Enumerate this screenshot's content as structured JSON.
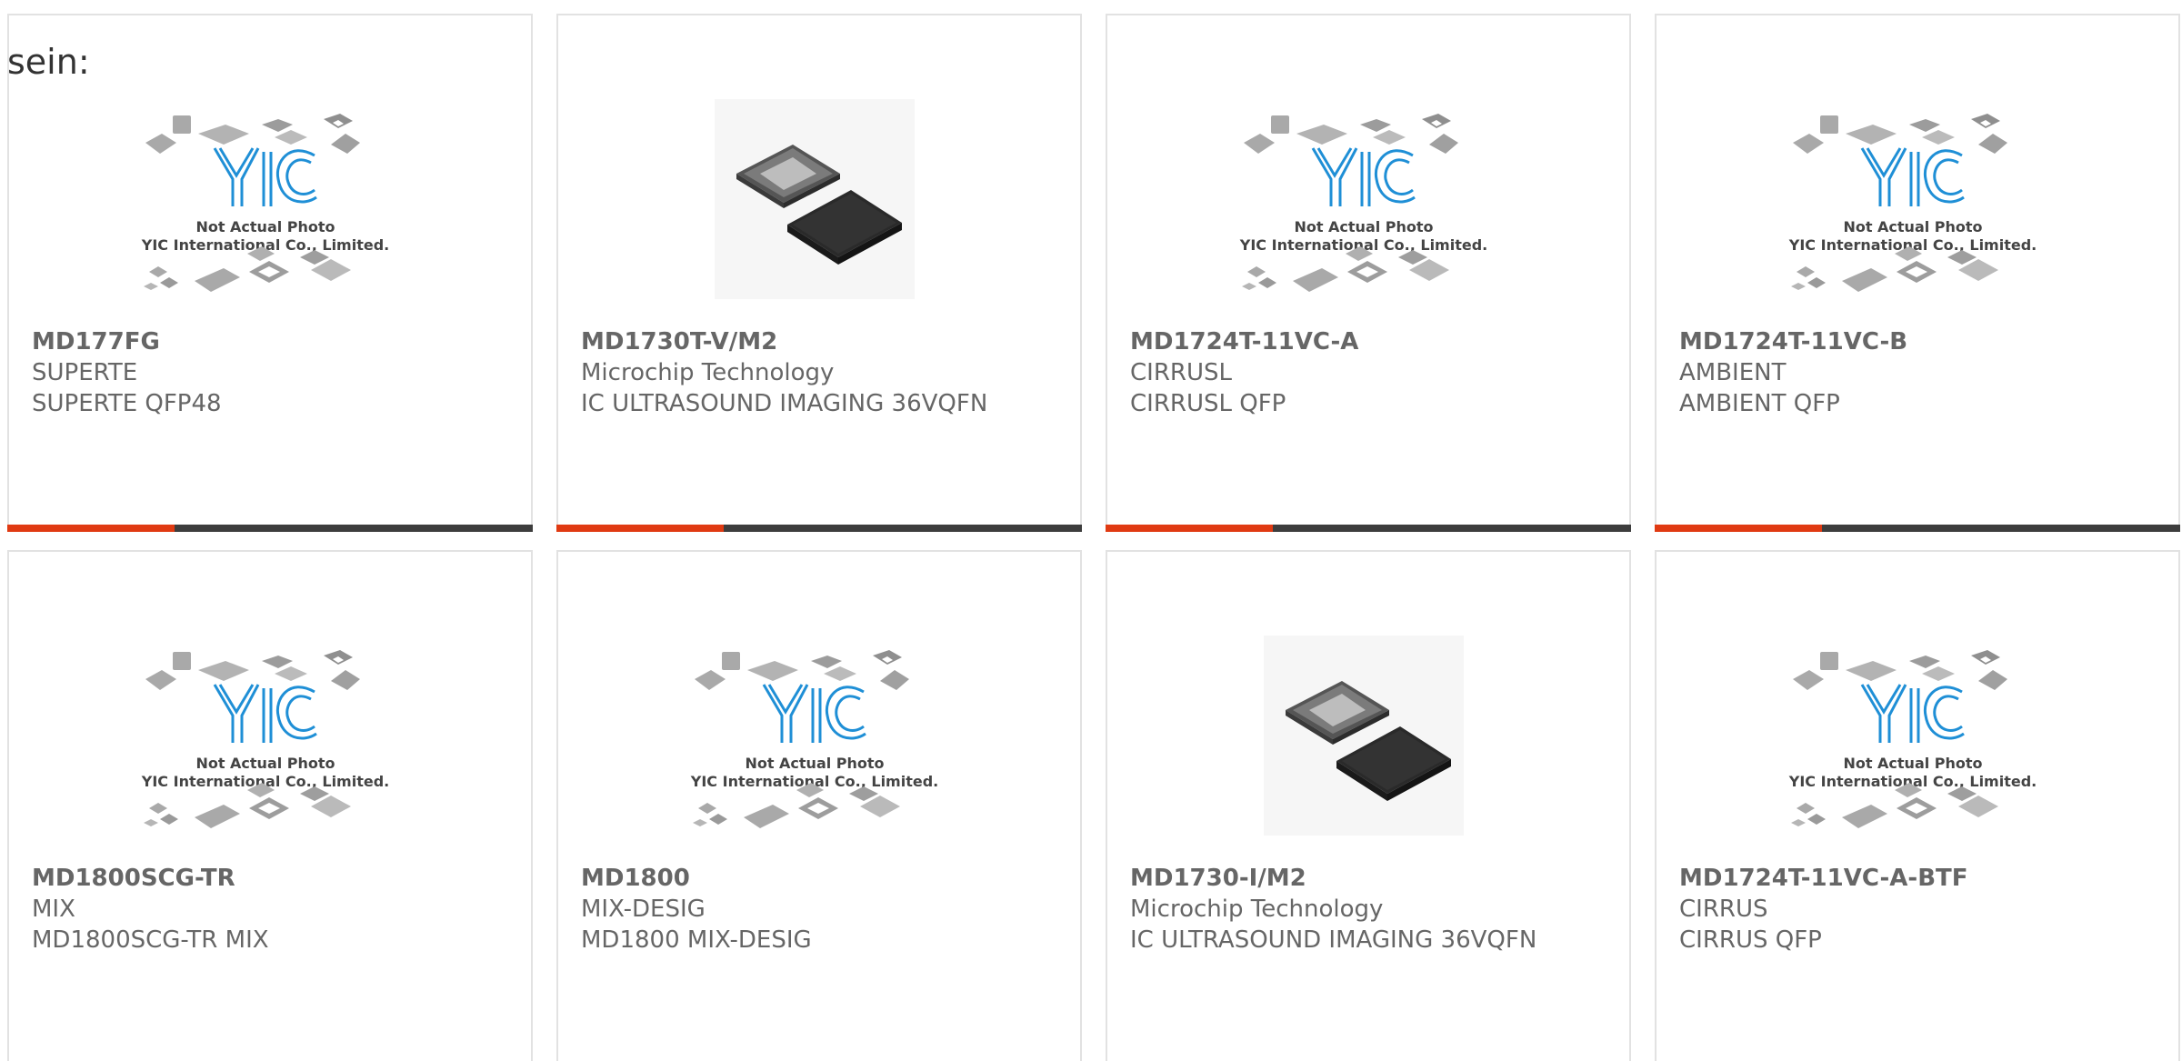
{
  "prefix_text": "sein:",
  "colors": {
    "accent_bar": "#e03a12",
    "dark_bar": "#3d3d3d",
    "text": "#666666",
    "logo_blue": "#1f8fd6"
  },
  "placeholder_image": {
    "caption_line1": "Not Actual Photo",
    "caption_line2": "YIC International Co., Limited.",
    "logo_text": "YIC"
  },
  "products": [
    {
      "part_number": "MD177FG",
      "manufacturer": "SUPERTE",
      "description": "SUPERTE QFP48",
      "image_type": "placeholder"
    },
    {
      "part_number": "MD1730T-V/M2",
      "manufacturer": "Microchip Technology",
      "description": "IC ULTRASOUND IMAGING 36VQFN",
      "image_type": "qfn-chip"
    },
    {
      "part_number": "MD1724T-11VC-A",
      "manufacturer": "CIRRUSL",
      "description": "CIRRUSL QFP",
      "image_type": "placeholder"
    },
    {
      "part_number": "MD1724T-11VC-B",
      "manufacturer": "AMBIENT",
      "description": "AMBIENT QFP",
      "image_type": "placeholder"
    },
    {
      "part_number": "MD1800SCG-TR",
      "manufacturer": "MIX",
      "description": "MD1800SCG-TR MIX",
      "image_type": "placeholder"
    },
    {
      "part_number": "MD1800",
      "manufacturer": "MIX-DESIG",
      "description": "MD1800 MIX-DESIG",
      "image_type": "placeholder"
    },
    {
      "part_number": "MD1730-I/M2",
      "manufacturer": "Microchip Technology",
      "description": "IC ULTRASOUND IMAGING 36VQFN",
      "image_type": "qfn-chip"
    },
    {
      "part_number": "MD1724T-11VC-A-BTF",
      "manufacturer": "CIRRUS",
      "description": "CIRRUS QFP",
      "image_type": "placeholder"
    }
  ]
}
